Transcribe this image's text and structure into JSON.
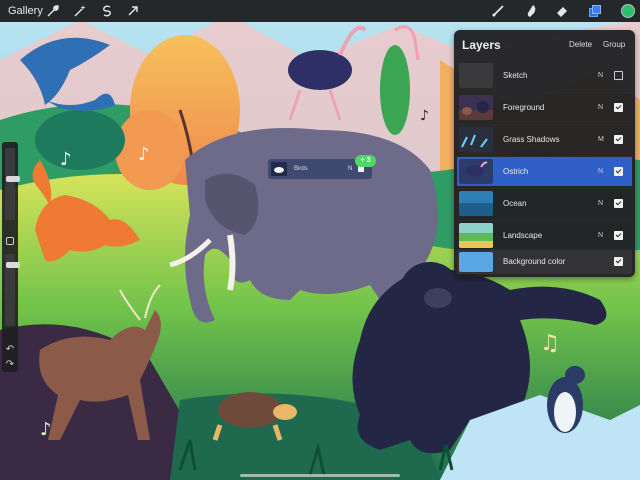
{
  "topbar": {
    "gallery_label": "Gallery",
    "left_tools": [
      "wrench-icon",
      "magic-wand-icon",
      "selection-icon",
      "transform-arrow-icon"
    ],
    "right_tools": [
      "brush-icon",
      "smudge-icon",
      "eraser-icon",
      "layers-icon"
    ],
    "active_color": "#2bbf6d"
  },
  "layers_panel": {
    "title": "Layers",
    "delete_label": "Delete",
    "group_label": "Group",
    "layers": [
      {
        "name": "Sketch",
        "mode": "N",
        "visible": false
      },
      {
        "name": "Foreground",
        "mode": "N",
        "visible": true
      },
      {
        "name": "Grass Shadows",
        "mode": "M",
        "visible": true
      },
      {
        "name": "Ostrich",
        "mode": "N",
        "visible": true
      },
      {
        "name": "Ocean",
        "mode": "N",
        "visible": true
      },
      {
        "name": "Landscape",
        "mode": "N",
        "visible": true
      },
      {
        "name": "Background color",
        "mode": "",
        "visible": true
      }
    ]
  },
  "drag_chip": {
    "name": "Birds",
    "mode": "N",
    "count": "+ 3"
  },
  "colors": {
    "accent_blue": "#2f5fc7",
    "badge_green": "#4cd964",
    "background_color": "#5aa7e3"
  }
}
